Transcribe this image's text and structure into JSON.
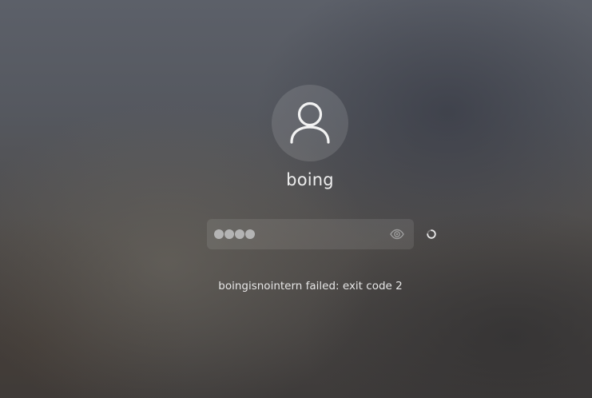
{
  "user": {
    "avatar_icon": "user-icon",
    "name": "boing"
  },
  "password": {
    "masked_length": 4,
    "reveal_icon": "eye-icon",
    "status_icon": "spinner-icon"
  },
  "status": {
    "message": "boingisnointern failed: exit code 2"
  },
  "colors": {
    "text": "#eeeeee",
    "field_background": "#5d5b5a",
    "dot": "#b4b4b4"
  }
}
